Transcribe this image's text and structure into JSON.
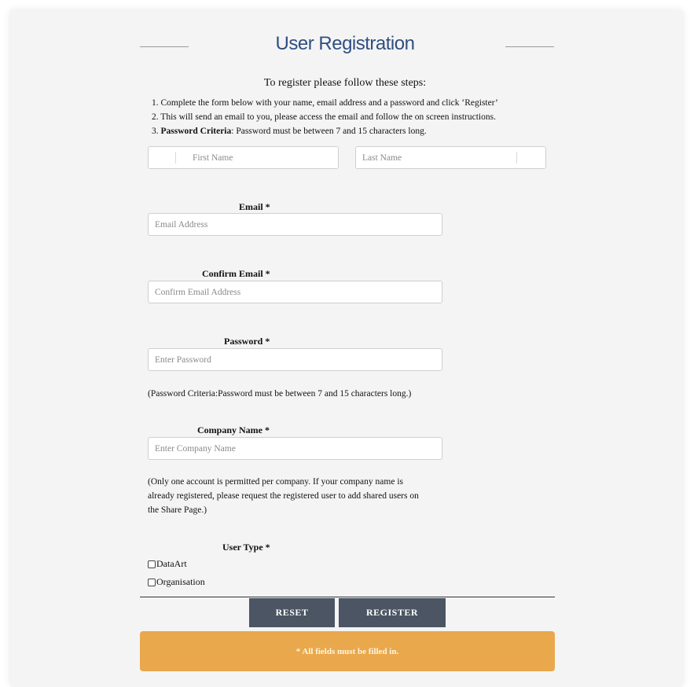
{
  "page": {
    "title": "User Registration",
    "intro_heading": "To register please follow these steps:",
    "steps": [
      "1. Complete the form below with your name, email address and a password and click ‘Register’",
      "2. This will send an email to you, please access the email and follow the on screen instructions.",
      "3."
    ],
    "step3_bold": "Password Criteria",
    "step3_rest": ": Password must be between 7 and 15 characters long."
  },
  "form": {
    "first_name_placeholder": "First Name",
    "last_name_placeholder": "Last Name",
    "email_label": "Email *",
    "email_placeholder": "Email Address",
    "confirm_email_label": "Confirm Email *",
    "confirm_email_placeholder": "Confirm Email Address",
    "password_label": "Password *",
    "password_placeholder": "Enter Password",
    "password_note": "(Password Criteria:Password must be between 7 and 15 characters long.)",
    "company_label": "Company Name *",
    "company_placeholder": "Enter Company Name",
    "company_note_lines": [
      "(Only one account is permitted per company. If your company name is",
      "already registered, please request the registered user to add shared users on",
      "the Share Page.)"
    ],
    "user_type_label": "User Type *",
    "user_type_options": [
      "DataArt",
      "Organisation"
    ]
  },
  "actions": {
    "reset_label": "RESET",
    "register_label": "REGISTER"
  },
  "alert": {
    "message": "* All fields must be filled in.",
    "color": "#e9a84c"
  },
  "colors": {
    "title": "#2f4f82",
    "button": "#4b5563",
    "background": "#f4f4f4"
  }
}
